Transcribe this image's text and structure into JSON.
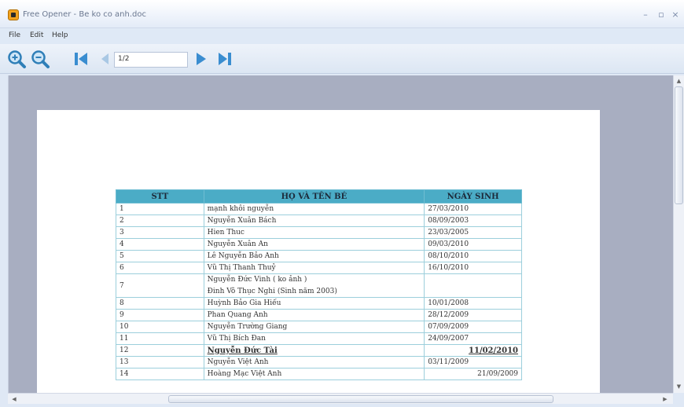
{
  "window": {
    "title": "Free Opener - Be ko co anh.doc"
  },
  "menu": {
    "file": "File",
    "edit": "Edit",
    "help": "Help"
  },
  "toolbar": {
    "page_value": "1/2"
  },
  "table": {
    "headers": [
      "STT",
      "HỌ VÀ TÊN BÉ",
      "NGÀY SINH"
    ],
    "rows": [
      [
        "1",
        "mạnh khôi nguyễn",
        "27/03/2010"
      ],
      [
        "2",
        "Nguyễn Xuân Bách",
        "08/09/2003"
      ],
      [
        "3",
        "Hien Thuc",
        "23/03/2005"
      ],
      [
        "4",
        "Nguyễn Xuân An",
        "09/03/2010"
      ],
      [
        "5",
        "Lê Nguyễn Bảo Anh",
        "08/10/2010"
      ],
      [
        "6",
        "Vũ Thị Thanh Thuỷ",
        "16/10/2010"
      ],
      [
        "7",
        "Nguyễn Đức Vinh ( ko ảnh )",
        ""
      ],
      [
        "",
        "Đinh Võ Thục Nghi (Sinh năm 2003)",
        ""
      ],
      [
        "8",
        "Huỳnh Bảo Gia Hiếu",
        "10/01/2008"
      ],
      [
        "9",
        "Phan Quang Anh",
        "28/12/2009"
      ],
      [
        "10",
        "Nguyễn Trường Giang",
        "07/09/2009"
      ],
      [
        "11",
        "Vũ Thị Bích Đan",
        "24/09/2007"
      ],
      [
        "12",
        "Nguyễn Đức Tài",
        "11/02/2010"
      ],
      [
        "13",
        "Nguyễn Việt Anh",
        "03/11/2009"
      ],
      [
        "14",
        "Hoàng Mạc Việt Anh",
        "21/09/2009"
      ]
    ]
  }
}
